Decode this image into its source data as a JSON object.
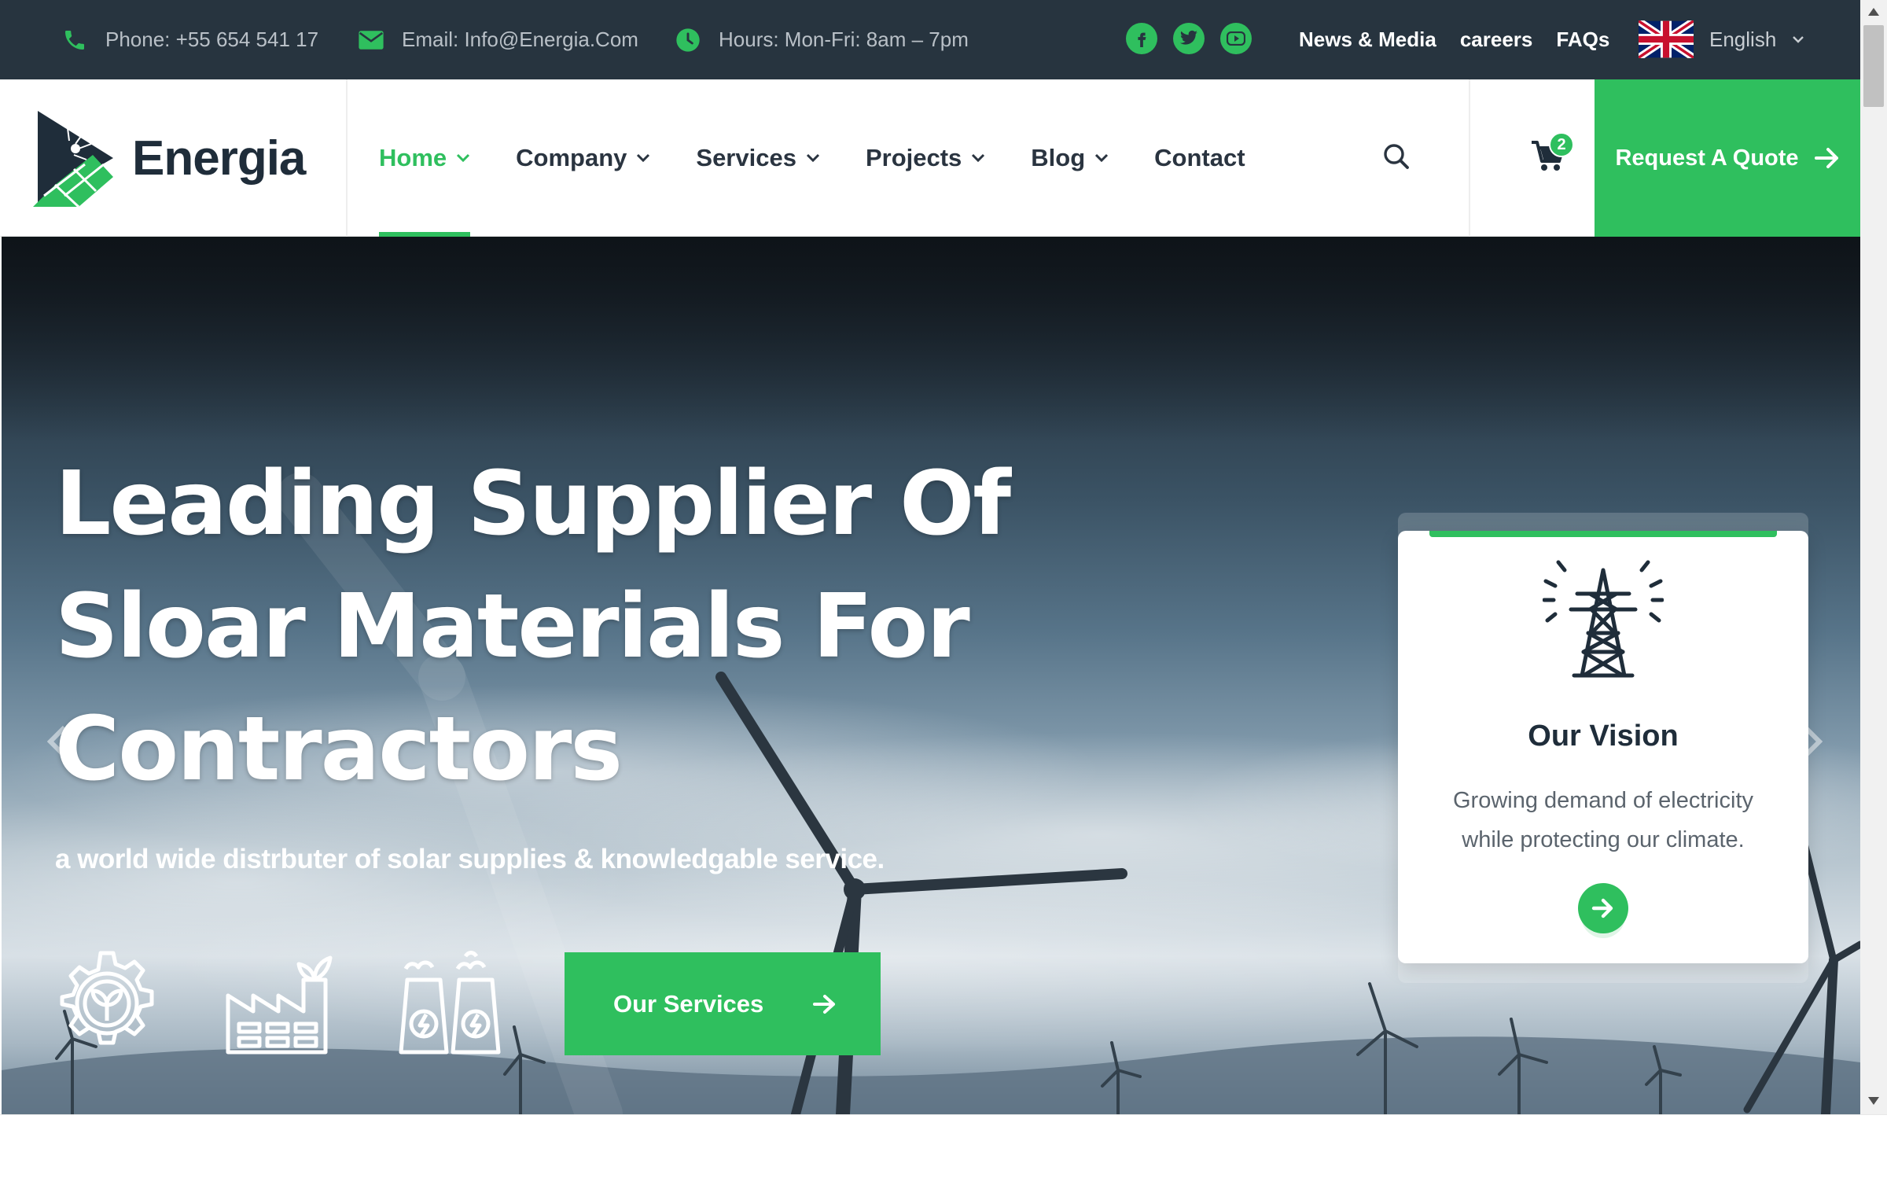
{
  "topbar": {
    "phone": "Phone: +55 654 541 17",
    "email": "Email: Info@Energia.Com",
    "hours": "Hours: Mon-Fri: 8am – 7pm",
    "social": [
      "facebook-icon",
      "twitter-icon",
      "youtube-icon"
    ],
    "links": [
      "News & Media",
      "careers",
      "FAQs"
    ],
    "language": "English"
  },
  "header": {
    "brand": "Energia",
    "nav": [
      {
        "label": "Home",
        "dropdown": true,
        "active": true
      },
      {
        "label": "Company",
        "dropdown": true
      },
      {
        "label": "Services",
        "dropdown": true
      },
      {
        "label": "Projects",
        "dropdown": true
      },
      {
        "label": "Blog",
        "dropdown": true
      },
      {
        "label": "Contact",
        "dropdown": false
      }
    ],
    "cart_count": "2",
    "quote_label": "Request A Quote"
  },
  "hero": {
    "title_lines": [
      "Leading Supplier Of",
      "Sloar Materials For",
      "Contractors"
    ],
    "subtitle": "a world wide distrbuter of solar supplies & knowledgable service.",
    "features": [
      "eco-gear-icon",
      "eco-factory-icon",
      "power-plant-icon"
    ],
    "cta_label": "Our Services"
  },
  "card": {
    "icon": "transmission-tower-icon",
    "title": "Our Vision",
    "text_lines": [
      "Growing demand of electricity",
      "while protecting our climate."
    ]
  },
  "colors": {
    "accent": "#2fbf5e",
    "topbar_bg": "#27343f",
    "dark_text": "#1f2d3a"
  }
}
